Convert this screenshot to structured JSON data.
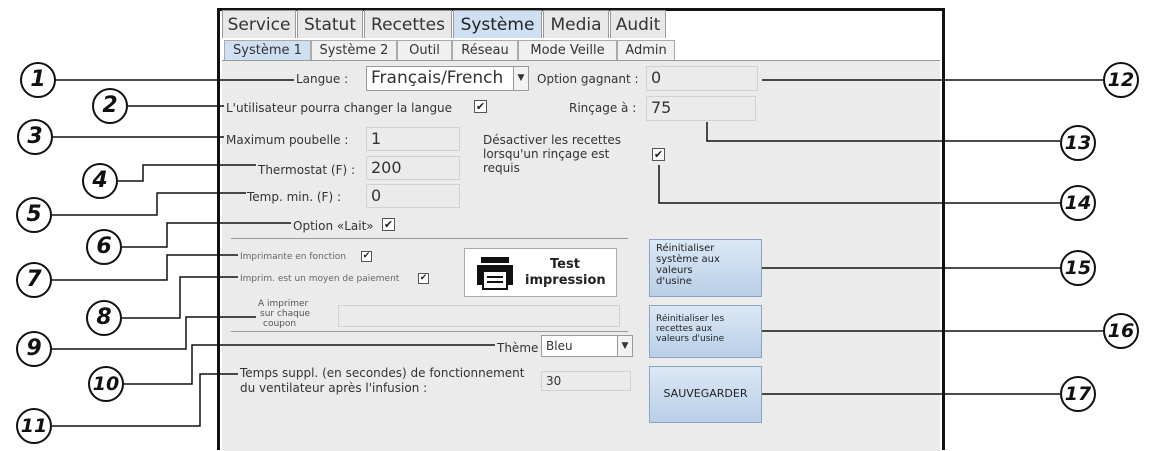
{
  "tabs": [
    "Service",
    "Statut",
    "Recettes",
    "Système",
    "Media",
    "Audit"
  ],
  "subtabs": [
    "Système 1",
    "Système 2",
    "Outil",
    "Réseau",
    "Mode Veille",
    "Admin"
  ],
  "form": {
    "langue_label": "Langue :",
    "langue_value": "Français/French",
    "change_lang_label": "L'utilisateur pourra changer la langue",
    "max_poubelle_label": "Maximum poubelle :",
    "max_poubelle_value": "1",
    "thermostat_label": "Thermostat (F) :",
    "thermostat_value": "200",
    "temp_min_label": "Temp. min. (F) :",
    "temp_min_value": "0",
    "option_lait_label": "Option «Lait»",
    "option_gagnant_label": "Option gagnant :",
    "option_gagnant_value": "0",
    "rincage_label": "Rinçage à :",
    "rincage_value": "75",
    "desactiver_label_1": "Désactiver les recettes",
    "desactiver_label_2": "lorsqu'un rinçage est",
    "desactiver_label_3": "requis",
    "imprimante_label": "Imprimante en fonction",
    "imprim_paiement_label": "Imprim. est un moyen de paiement",
    "a_imprimer_1": "A imprimer",
    "a_imprimer_2": "sur chaque",
    "a_imprimer_3": "coupon",
    "test_1": "Test",
    "test_2": "impression",
    "theme_label": "Thème",
    "theme_value": "Bleu",
    "temps_label_1": "Temps suppl. (en secondes) de fonctionnement",
    "temps_label_2": "du ventilateur après l'infusion :",
    "temps_value": "30",
    "check_mark": "✔"
  },
  "buttons": {
    "reinit_sys_1": "Réinitialiser",
    "reinit_sys_2": "système aux",
    "reinit_sys_3": "valeurs",
    "reinit_sys_4": "d'usine",
    "reinit_rec_1": "Réinitialiser les",
    "reinit_rec_2": "recettes aux",
    "reinit_rec_3": "valeurs d'usine",
    "save": "SAUVEGARDER"
  },
  "callouts": [
    "1",
    "2",
    "3",
    "4",
    "5",
    "6",
    "7",
    "8",
    "9",
    "10",
    "11",
    "12",
    "13",
    "14",
    "15",
    "16",
    "17"
  ],
  "colors": {
    "active_tab": "#cfe0f2",
    "panel": "#ebebeb"
  }
}
